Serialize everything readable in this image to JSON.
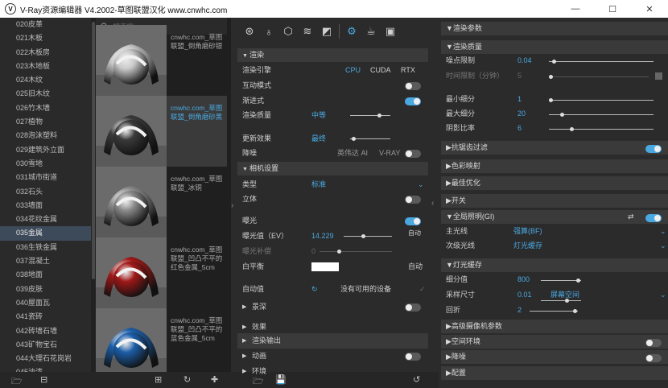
{
  "window": {
    "title": "V-Ray资源编辑器 V4.2002-草图联盟汉化 www.cnwhc.com",
    "logo": "V",
    "min": "—",
    "max": "☐",
    "close": "✕"
  },
  "categories": [
    "020皮革",
    "021木板",
    "022木板房",
    "023木地板",
    "024木纹",
    "025旧木纹",
    "026竹木墙",
    "027植物",
    "028泡沫塑料",
    "029建筑外立面",
    "030雪地",
    "031城市街道",
    "032石头",
    "033墙面",
    "034花纹金属",
    "035金属",
    "036生铁金属",
    "037混凝土",
    "038地面",
    "039皮肤",
    "040屋面瓦",
    "041瓷砖",
    "042砖墙石墙",
    "043矿物宝石",
    "044大理石花岗岩",
    "045油漆"
  ],
  "active_category_index": 15,
  "search": {
    "placeholder": "搜索库"
  },
  "materials": [
    {
      "name": "cnwhc.com_草图联盟_倒角磨砂银",
      "color": "#c8c8c8",
      "selected": false
    },
    {
      "name": "cnwhc.com_草图联盟_倒角磨砂黑",
      "color": "#3a3a3a",
      "selected": true
    },
    {
      "name": "cnwhc.com_草图联盟_冰铜",
      "color": "#8a8a8a",
      "selected": false
    },
    {
      "name": "cnwhc.com_草图联盟_凹凸不平的红色金属_5cm",
      "color": "#a01818",
      "selected": false
    },
    {
      "name": "cnwhc.com_草图联盟_凹凸不平的蓝色金属_5cm",
      "color": "#1c5ea8",
      "selected": false
    }
  ],
  "toolbar": {
    "icons": [
      "sphere-grid-icon",
      "bulb-icon",
      "cube-icon",
      "layers-icon",
      "texture-icon",
      "gear-icon",
      "teapot-icon",
      "frame-icon"
    ]
  },
  "render": {
    "section": "渲染",
    "engine_label": "渲染引擎",
    "engine_options": [
      "CPU",
      "CUDA",
      "RTX"
    ],
    "interactive_label": "互动模式",
    "progressive_label": "渐进式",
    "quality_label": "渲染质量",
    "quality_value": "中等",
    "update_label": "更新效果",
    "update_value": "最终",
    "denoise_label": "降噪",
    "denoise_options": [
      "英伟达 AI",
      "V-RAY"
    ]
  },
  "camera": {
    "section": "相机设置",
    "type_label": "类型",
    "type_value": "标准",
    "stereo_label": "立体",
    "exposure_label": "曝光",
    "ev_label": "曝光值（EV）",
    "ev_value": "14.229",
    "ev_auto": "自动",
    "comp_label": "曝光补偿",
    "comp_value": "0",
    "wb_label": "白平衡",
    "wb_auto": "自动",
    "auto_label": "自动值",
    "auto_value": "没有可用的设备"
  },
  "collapsed": [
    "景深",
    "效果",
    "渲染输出",
    "动画",
    "环境"
  ],
  "right": {
    "top_section": "渲染参数",
    "quality_section": "渲染质量",
    "noise_label": "噪点限制",
    "noise_value": "0.04",
    "time_label": "时间限制（分钟）",
    "time_value": "5",
    "min_sub_label": "最小细分",
    "min_sub_value": "1",
    "max_sub_label": "最大细分",
    "max_sub_value": "20",
    "shadow_label": "阴影比率",
    "shadow_value": "6",
    "aa_section": "抗锯齿过滤",
    "color_section": "色彩映射",
    "opt_section": "最佳优化",
    "switch_section": "开关",
    "gi_section": "全局照明(GI)",
    "primary_label": "主光线",
    "primary_value": "强算(BF)",
    "secondary_label": "次级光线",
    "secondary_value": "灯光缓存",
    "lc_section": "灯光缓存",
    "subdiv_label": "细分值",
    "subdiv_value": "800",
    "sample_label": "采样尺寸",
    "sample_value": "0.01",
    "sample_mode": "屏幕空间",
    "retrace_label": "回折",
    "retrace_value": "2",
    "adv_section": "高级摄像机参数",
    "env_section": "空间环境",
    "denoise_section": "降噪",
    "config_section": "配置"
  },
  "colors": {
    "accent": "#4aa8e0",
    "panel": "#2b2b2b",
    "header": "#3a3a3a"
  }
}
